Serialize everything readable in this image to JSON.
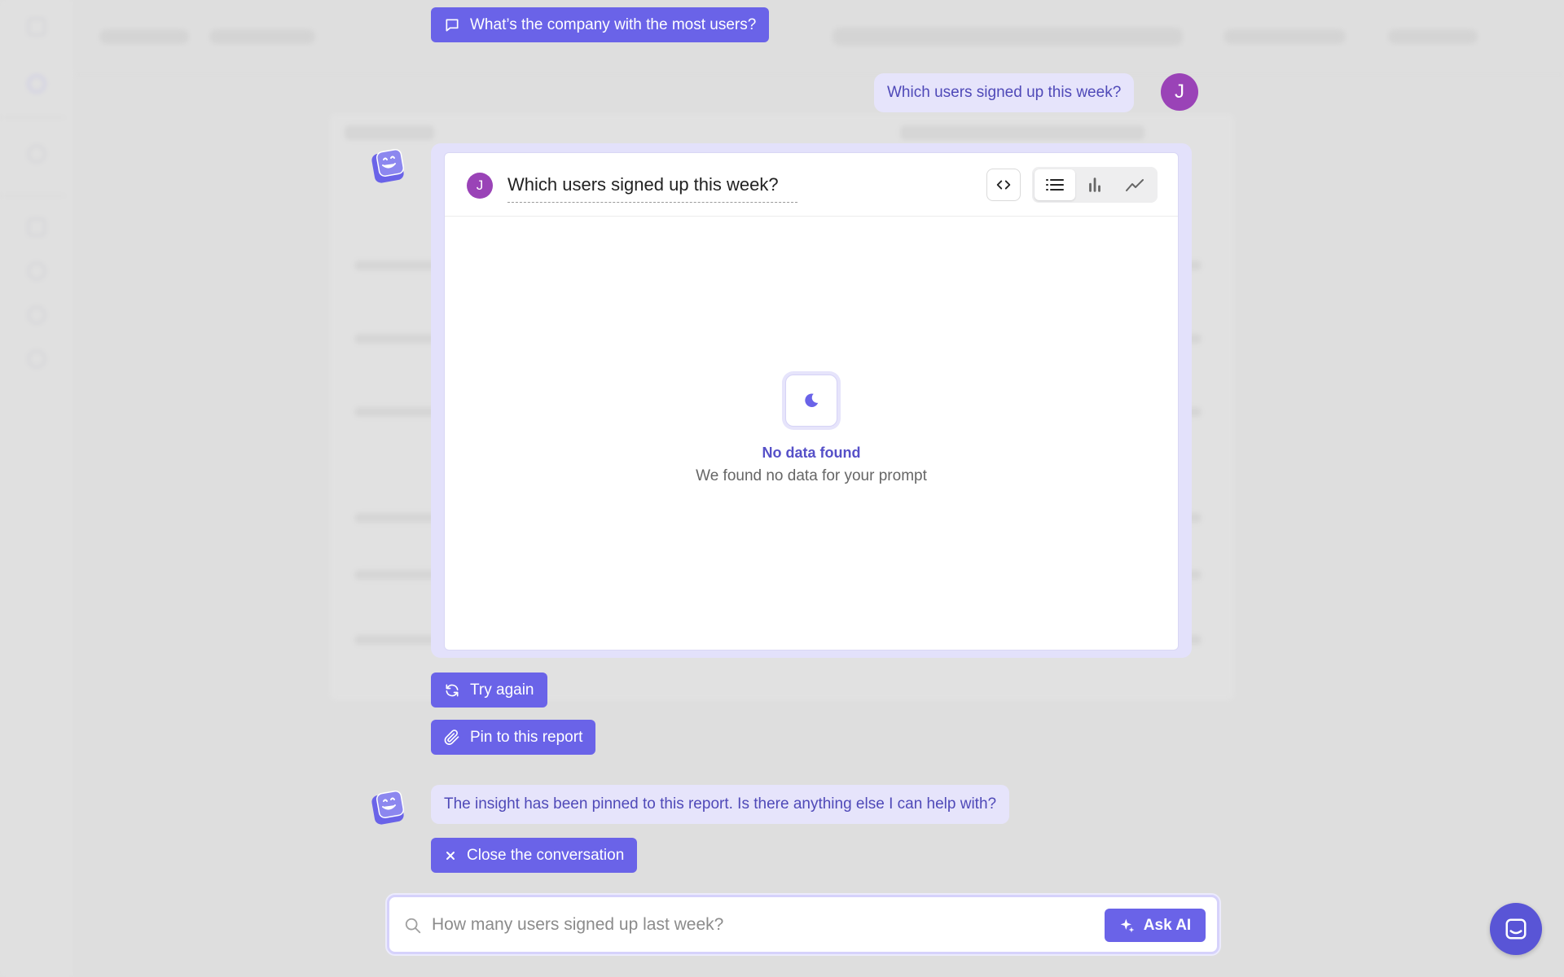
{
  "suggestion": {
    "label": "What’s the company with the most users?"
  },
  "user_message": {
    "text": "Which users signed up this week?",
    "avatar_initial": "J"
  },
  "insight_card": {
    "avatar_initial": "J",
    "question": "Which users signed up this week?",
    "views": [
      "code-icon",
      "list-icon",
      "bar-chart-icon",
      "line-chart-icon"
    ],
    "active_view": "list",
    "empty_state": {
      "title": "No data found",
      "subtitle": "We found no data for your prompt"
    }
  },
  "actions": {
    "try_again": "Try again",
    "pin": "Pin to this report"
  },
  "bot_message": {
    "text": "The insight has been pinned to this report. Is there anything else I can help with?"
  },
  "close_conversation": "Close the conversation",
  "search": {
    "placeholder": "How many users signed up last week?",
    "button": "Ask AI"
  },
  "colors": {
    "accent": "#6a63e8",
    "bubble": "#e6e4fb",
    "avatar": "#9a43b7"
  }
}
